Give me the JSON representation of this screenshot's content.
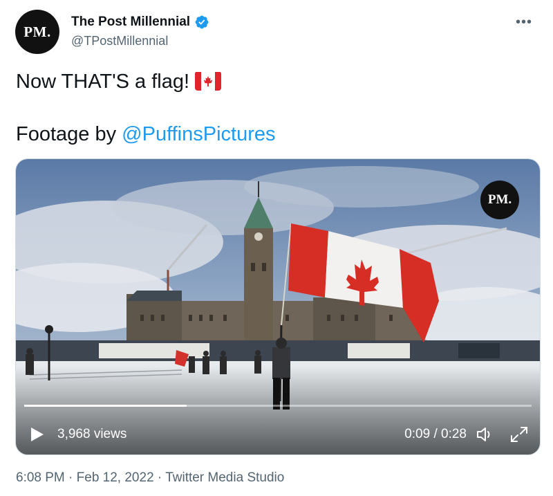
{
  "author": {
    "avatar_text": "PM.",
    "display_name": "The Post Millennial",
    "handle": "@TPostMillennial",
    "verified_color": "#1d9bf0"
  },
  "menu": {
    "more_icon": "more-horizontal-icon"
  },
  "tweet": {
    "line1": "Now THAT'S a flag!",
    "emoji": "canadian-flag-emoji",
    "line2_prefix": "Footage by ",
    "mention": "@PuffinsPictures",
    "mention_color": "#1d9bf0"
  },
  "video": {
    "watermark": "PM.",
    "views": "3,968 views",
    "time": "0:09 / 0:28",
    "progress": 0.32,
    "play_icon": "play-icon",
    "volume_icon": "volume-icon",
    "fullscreen_icon": "fullscreen-icon"
  },
  "footer": {
    "time": "6:08 PM",
    "sep1": "·",
    "date": "Feb 12, 2022",
    "sep2": "·",
    "source": "Twitter Media Studio"
  }
}
